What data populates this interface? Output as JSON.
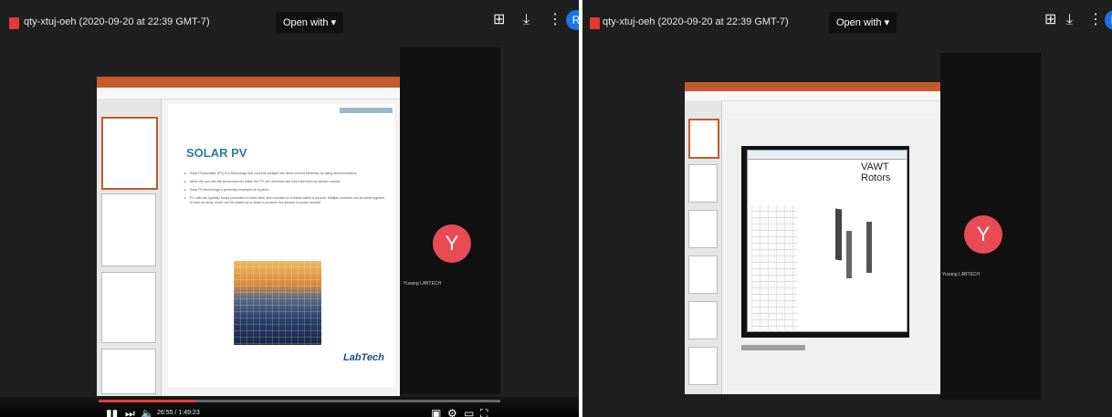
{
  "left": {
    "title": "qty-xtuj-oeh (2020-09-20 at 22:39 GMT-7)",
    "open_with": "Open with ▾",
    "avatar_letter": "R",
    "participant_letter": "Y",
    "participant_name": "Yusang LABTECH",
    "slide": {
      "title": "SOLAR PV",
      "bullets": [
        "Solar Photovoltaic (PV) is a technology that converts sunlight into direct current electricity by using semiconductors.",
        "When the sun hits the semiconductor within the PV cell, electrons are freed and form an electric current.",
        "Solar PV technology is generally employed on a panel.",
        "PV cells are typically found connected to each other and mounted on a frame called a module. Multiple modules can be wired together to form an array, which can be scaled up or down to produce the amount of power needed"
      ],
      "logo": "LabTech"
    },
    "video": {
      "time": "26:55 / 1:49:23",
      "progress": 0.24
    }
  },
  "right": {
    "title": "qty-xtuj-oeh (2020-09-20 at 22:39 GMT-7)",
    "open_with": "Open with ▾",
    "avatar_letter": "R",
    "participant_letter": "Y",
    "participant_name": "Yusang LABTECH",
    "vawt_title": "VAWT Rotors"
  },
  "colors": {
    "accent": "#c55a2c",
    "avatar": "#e84b55",
    "progress": "#e53935",
    "brand_blue": "#1a73e8"
  },
  "icons": {
    "file": "file-icon",
    "add_to_drive": "add-to-drive-icon",
    "download": "download-icon",
    "more": "more-vert-icon",
    "play": "play-icon",
    "next": "next-icon",
    "volume": "volume-icon",
    "settings": "gear-icon",
    "fullscreen": "fullscreen-icon"
  }
}
